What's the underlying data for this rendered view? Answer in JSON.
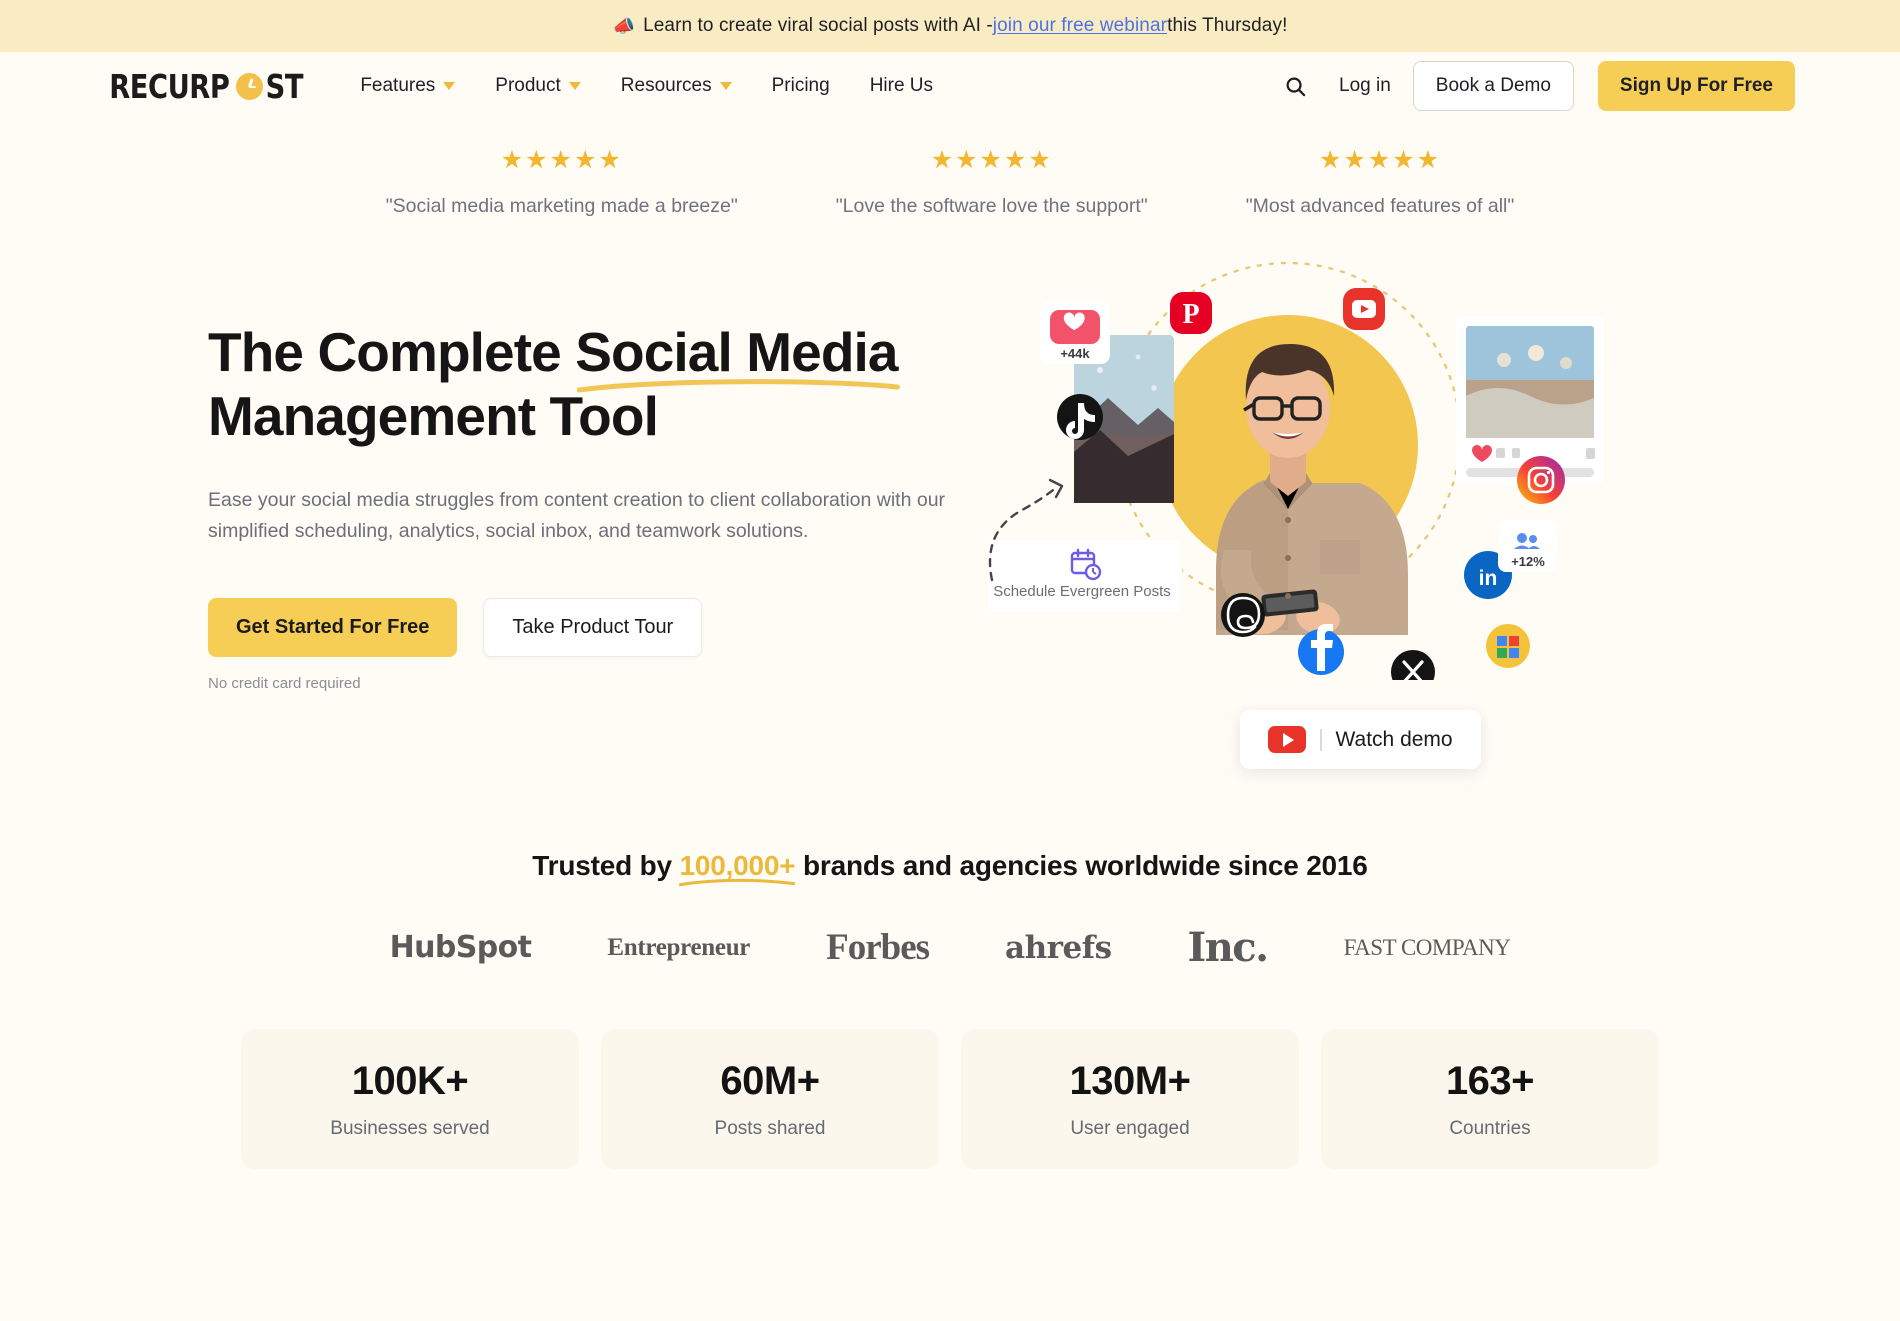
{
  "announcement": {
    "icon": "megaphone-icon",
    "text_before": "Learn to create viral social posts with AI - ",
    "link_text": "join our free webinar",
    "text_after": " this Thursday!"
  },
  "nav": {
    "logo": {
      "part1": "RECURP",
      "o_icon": "clock-o-icon",
      "part2": "ST"
    },
    "links": [
      {
        "label": "Features",
        "has_dropdown": true
      },
      {
        "label": "Product",
        "has_dropdown": true
      },
      {
        "label": "Resources",
        "has_dropdown": true
      },
      {
        "label": "Pricing",
        "has_dropdown": false
      },
      {
        "label": "Hire Us",
        "has_dropdown": false
      }
    ],
    "search_icon": "search-icon",
    "login_label": "Log in",
    "book_demo_label": "Book a Demo",
    "signup_label": "Sign Up For Free"
  },
  "reviews": [
    {
      "stars": "★★★★★",
      "rating": 5,
      "quote": "\"Social media marketing made a breeze\""
    },
    {
      "stars": "★★★★★",
      "rating": 5,
      "quote": "\"Love the software love the support\""
    },
    {
      "stars": "★★★★★",
      "rating": 5,
      "quote": "\"Most advanced features of all\""
    }
  ],
  "hero": {
    "title_line1_a": "The Complete ",
    "title_line1_highlight": "Social Media",
    "title_line2": "Management Tool",
    "subtitle": "Ease your social media struggles from content creation to client collaboration with our simplified scheduling, analytics, social inbox, and teamwork solutions.",
    "cta_primary": "Get Started For Free",
    "cta_secondary": "Take Product Tour",
    "no_credit_card": "No credit card required",
    "watch_demo": "Watch demo",
    "art": {
      "schedule_card_label": "Schedule Evergreen Posts",
      "likes_badge": "+44k",
      "followers_badge": "+12%",
      "social_icons": [
        "pinterest-icon",
        "youtube-icon",
        "instagram-icon",
        "linkedin-icon",
        "facebook-icon",
        "x-twitter-icon",
        "tiktok-icon",
        "threads-icon",
        "google-business-icon"
      ]
    }
  },
  "trusted": {
    "prefix": "Trusted by ",
    "number": "100,000+",
    "suffix": " brands and agencies worldwide since 2016",
    "brands": [
      {
        "name": "HubSpot",
        "style": "hubspot"
      },
      {
        "name": "Entrepreneur",
        "style": "entrepreneur"
      },
      {
        "name": "Forbes",
        "style": "forbes"
      },
      {
        "name": "ahrefs",
        "style": "ahrefs"
      },
      {
        "name": "Inc.",
        "style": "inc"
      },
      {
        "name": "FAST COMPANY",
        "style": "fastcompany"
      }
    ]
  },
  "stats": [
    {
      "value": "100K+",
      "label": "Businesses served"
    },
    {
      "value": "60M+",
      "label": "Posts shared"
    },
    {
      "value": "130M+",
      "label": "User engaged"
    },
    {
      "value": "163+",
      "label": "Countries"
    }
  ],
  "colors": {
    "brand_yellow": "#F7CE55",
    "banner_bg": "#FAECC2",
    "page_bg": "#FEFCF5",
    "link_blue": "#4B72E8",
    "star_gold": "#F2B630",
    "stat_card_bg": "#FBF7EC"
  }
}
